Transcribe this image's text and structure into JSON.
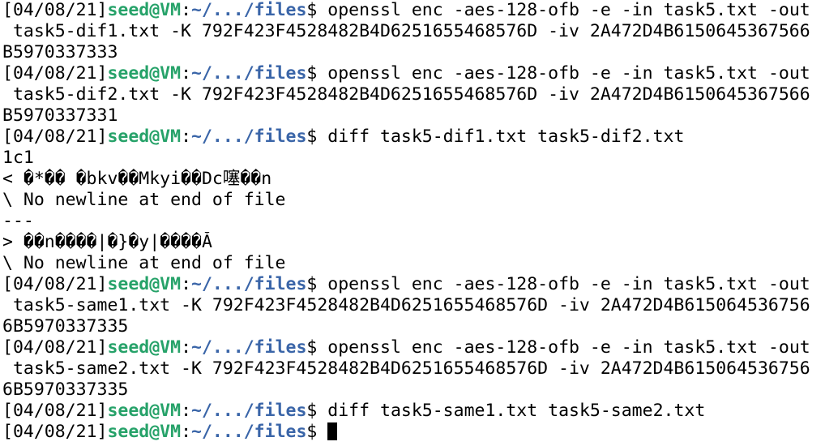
{
  "window": {
    "title": ""
  },
  "theme": {
    "background": "#ffffff",
    "foreground": "#000000",
    "user_host_color": "#26a269",
    "path_color": "#3a65a8"
  },
  "prompt": {
    "date": "[04/08/21]",
    "user_host": "seed@VM",
    "sep": ":",
    "path": "~/.../files",
    "symbol": "$ "
  },
  "lines": [
    {
      "kind": "cmd",
      "text": "openssl enc -aes-128-ofb -e -in task5.txt -out"
    },
    {
      "kind": "out",
      "text": " task5-dif1.txt -K 792F423F4528482B4D6251655468576D -iv 2A472D4B6150645367566"
    },
    {
      "kind": "out",
      "text": "B5970337333"
    },
    {
      "kind": "cmd",
      "text": "openssl enc -aes-128-ofb -e -in task5.txt -out"
    },
    {
      "kind": "out",
      "text": " task5-dif2.txt -K 792F423F4528482B4D6251655468576D -iv 2A472D4B6150645367566"
    },
    {
      "kind": "out",
      "text": "B5970337331"
    },
    {
      "kind": "cmd",
      "text": "diff task5-dif1.txt task5-dif2.txt"
    },
    {
      "kind": "out",
      "text": "1c1"
    },
    {
      "kind": "out",
      "text": "< �*�� �bkv��Mkyi��Dc噻��n"
    },
    {
      "kind": "out",
      "text": "\\ No newline at end of file"
    },
    {
      "kind": "out",
      "text": "---"
    },
    {
      "kind": "out",
      "text": "> ��n����|�}�y|����Ă"
    },
    {
      "kind": "out",
      "text": "\\ No newline at end of file"
    },
    {
      "kind": "cmd",
      "text": "openssl enc -aes-128-ofb -e -in task5.txt -out"
    },
    {
      "kind": "out",
      "text": " task5-same1.txt -K 792F423F4528482B4D6251655468576D -iv 2A472D4B615064536756"
    },
    {
      "kind": "out",
      "text": "6B5970337335"
    },
    {
      "kind": "cmd",
      "text": "openssl enc -aes-128-ofb -e -in task5.txt -out"
    },
    {
      "kind": "out",
      "text": " task5-same2.txt -K 792F423F4528482B4D6251655468576D -iv 2A472D4B615064536756"
    },
    {
      "kind": "out",
      "text": "6B5970337335"
    },
    {
      "kind": "cmd",
      "text": "diff task5-same1.txt task5-same2.txt"
    },
    {
      "kind": "prompt_cursor",
      "text": ""
    }
  ]
}
